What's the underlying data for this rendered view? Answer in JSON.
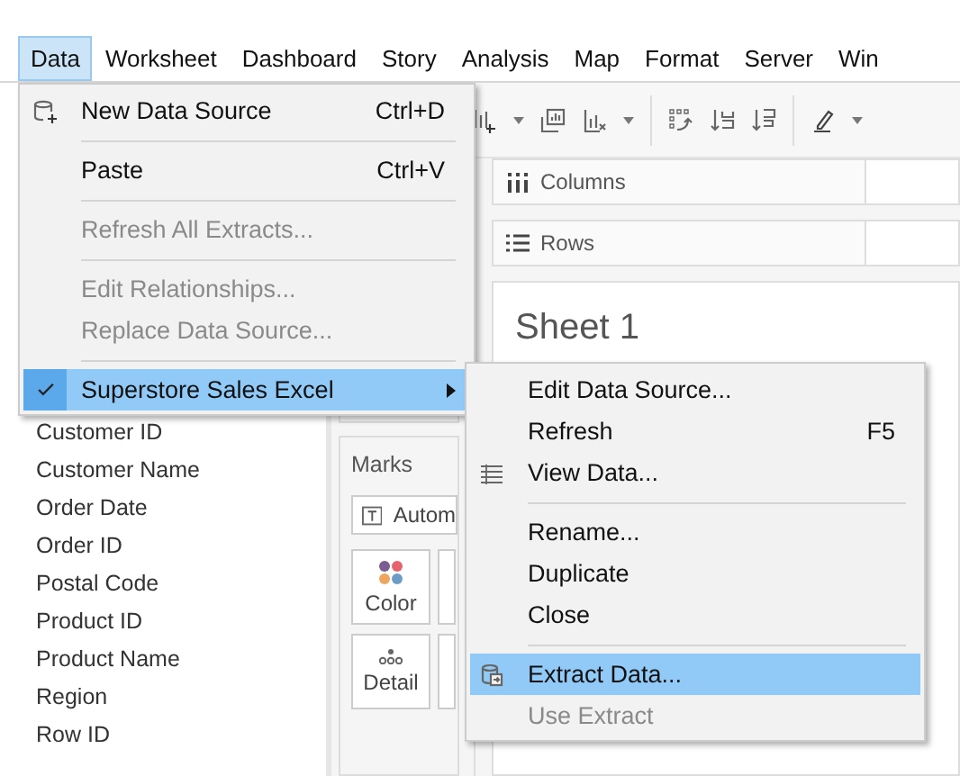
{
  "menu_bar": [
    {
      "label": "Data",
      "selected": true
    },
    {
      "label": "Worksheet",
      "selected": false
    },
    {
      "label": "Dashboard",
      "selected": false
    },
    {
      "label": "Story",
      "selected": false
    },
    {
      "label": "Analysis",
      "selected": false
    },
    {
      "label": "Map",
      "selected": false
    },
    {
      "label": "Format",
      "selected": false
    },
    {
      "label": "Server",
      "selected": false
    },
    {
      "label": "Win",
      "selected": false
    }
  ],
  "fields": [
    "Customer ID",
    "Customer Name",
    "Order Date",
    "Order ID",
    "Postal Code",
    "Product ID",
    "Product Name",
    "Region",
    "Row ID"
  ],
  "marks": {
    "title": "Marks",
    "mark_type": "Autom",
    "buttons": [
      {
        "label": "Color",
        "kind": "color"
      },
      {
        "label": "Detail",
        "kind": "detail"
      }
    ]
  },
  "shelves": [
    {
      "label": "Columns",
      "kind": "columns"
    },
    {
      "label": "Rows",
      "kind": "rows"
    }
  ],
  "sheet": {
    "title": "Sheet 1"
  },
  "data_menu": [
    {
      "kind": "iconic",
      "label": "New Data Source",
      "shortcut": "Ctrl+D",
      "disabled": false,
      "selected": false
    },
    {
      "kind": "separator"
    },
    {
      "kind": "plain",
      "label": "Paste",
      "shortcut": "Ctrl+V",
      "disabled": false,
      "selected": false
    },
    {
      "kind": "separator"
    },
    {
      "kind": "plain",
      "label": "Refresh All Extracts...",
      "disabled": true,
      "selected": false
    },
    {
      "kind": "separator"
    },
    {
      "kind": "plain",
      "label": "Edit Relationships...",
      "disabled": true,
      "selected": false
    },
    {
      "kind": "plain",
      "label": "Replace Data Source...",
      "disabled": true,
      "selected": false
    },
    {
      "kind": "separator"
    },
    {
      "kind": "submenu",
      "label": "Superstore Sales Excel",
      "checked": true,
      "disabled": false,
      "selected": true
    }
  ],
  "source_menu": [
    {
      "kind": "plain",
      "label": "Edit Data Source...",
      "disabled": false,
      "selected": false
    },
    {
      "kind": "plain",
      "label": "Refresh",
      "shortcut": "F5",
      "disabled": false,
      "selected": false
    },
    {
      "kind": "iconic",
      "label": "View Data...",
      "disabled": false,
      "selected": false
    },
    {
      "kind": "separator"
    },
    {
      "kind": "plain",
      "label": "Rename...",
      "disabled": false,
      "selected": false
    },
    {
      "kind": "plain",
      "label": "Duplicate",
      "disabled": false,
      "selected": false
    },
    {
      "kind": "plain",
      "label": "Close",
      "disabled": false,
      "selected": false
    },
    {
      "kind": "separator"
    },
    {
      "kind": "iconic",
      "label": "Extract Data...",
      "disabled": false,
      "selected": true
    },
    {
      "kind": "plain",
      "label": "Use Extract",
      "disabled": true,
      "selected": false
    }
  ]
}
